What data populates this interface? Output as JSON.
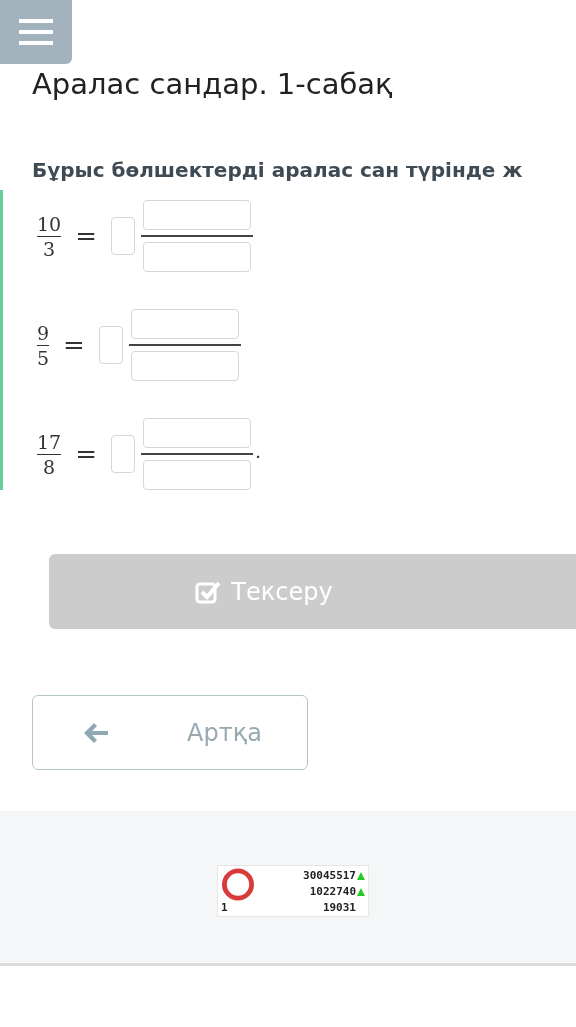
{
  "menu_button": {
    "kind": "hamburger"
  },
  "title": "Аралас сандар. 1-сабақ",
  "instruction": "Бұрыс бөлшектерді аралас сан түрінде ж",
  "equations": [
    {
      "numerator": "10",
      "denominator": "3",
      "equals": "="
    },
    {
      "numerator": "9",
      "denominator": "5",
      "equals": "="
    },
    {
      "numerator": "17",
      "denominator": "8",
      "equals": "=",
      "end": "."
    }
  ],
  "check_button": {
    "label": "Тексеру",
    "disabled": true
  },
  "back_button": {
    "label": "Артқа"
  },
  "counter": {
    "rank": "1",
    "rows": [
      {
        "value": "30045517",
        "up": true
      },
      {
        "value": "1022740",
        "up": true
      },
      {
        "value": "19031",
        "up": false
      }
    ]
  }
}
